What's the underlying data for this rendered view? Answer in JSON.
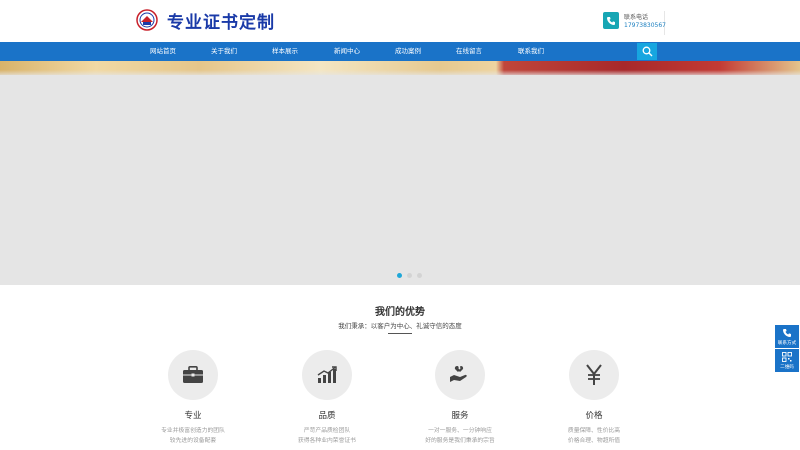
{
  "header": {
    "logo_text": "专业证书定制",
    "contact_label": "联系电话",
    "contact_phone": "17973830567"
  },
  "nav": {
    "items": [
      "网站首页",
      "关于我们",
      "样本展示",
      "新闻中心",
      "成功案例",
      "在线留言",
      "联系我们"
    ]
  },
  "banner": {
    "slide_count": 3,
    "active_slide": 1
  },
  "advantages": {
    "title": "我们的优势",
    "subtitle": "我们秉承：以客户为中心、礼诚守信的态度",
    "cards": [
      {
        "icon": "briefcase-icon",
        "title": "专业",
        "desc1": "专业并极富创造力的团队",
        "desc2": "较先进的设备配套"
      },
      {
        "icon": "chart-icon",
        "title": "品质",
        "desc1": "严苛产品质检团队",
        "desc2": "获得各种业内荣誉证书"
      },
      {
        "icon": "hand-wrench-icon",
        "title": "服务",
        "desc1": "一对一服务、一分钟响应",
        "desc2": "好的服务是我们秉承的宗旨"
      },
      {
        "icon": "yen-icon",
        "title": "价格",
        "desc1": "质量保障、性价比高",
        "desc2": "价格合理、物超所值"
      }
    ]
  },
  "side_widget": {
    "contact_label": "联系方式",
    "qrcode_label": "二维码"
  },
  "colors": {
    "brand_blue": "#1a73c8",
    "accent_teal": "#17a6b4",
    "logo_blue": "#1a3aa8"
  }
}
